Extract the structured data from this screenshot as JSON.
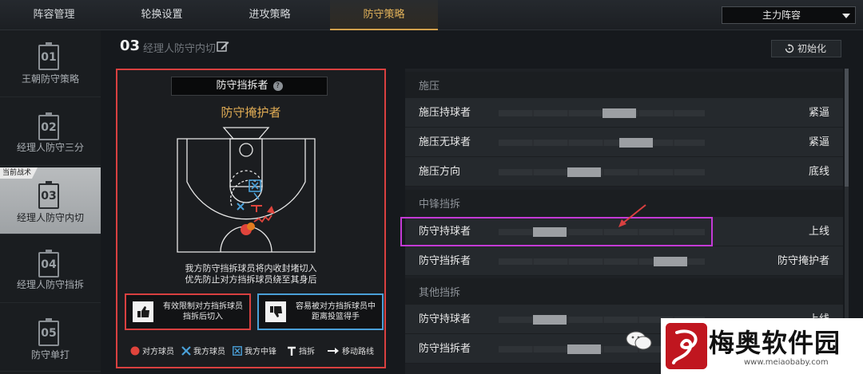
{
  "top_tabs": [
    "阵容管理",
    "轮换设置",
    "进攻策略",
    "防守策略"
  ],
  "active_tab": "防守策略",
  "lineup_select": "主力阵容",
  "sidebar": {
    "items": [
      {
        "num": "01",
        "label": "王朝防守策略"
      },
      {
        "num": "02",
        "label": "经理人防守三分"
      },
      {
        "num": "03",
        "label": "经理人防守内切"
      },
      {
        "num": "04",
        "label": "经理人防守挡拆"
      },
      {
        "num": "05",
        "label": "防守单打"
      }
    ],
    "current_tag": "当前战术"
  },
  "header": {
    "num": "03",
    "title": "经理人防守内切",
    "reset_label": "初始化"
  },
  "panel": {
    "title": "防守挡拆者",
    "help": "?",
    "subtitle": "防守掩护者",
    "desc_line1": "我方防守挡拆球员将内收封堵切入",
    "desc_line2": "优先防止对方挡拆球员绕至其身后",
    "pro_line1": "有效限制对方挡拆球员",
    "pro_line2": "挡拆后切入",
    "con_line1": "容易被对方挡拆球员中",
    "con_line2": "距离投篮得手",
    "legend": [
      "对方球员",
      "我方球员",
      "我方中锋",
      "挡拆",
      "移动路线"
    ]
  },
  "settings": {
    "sections": [
      {
        "title": "施压",
        "rows": [
          {
            "label": "施压持球者",
            "value": "紧逼",
            "level": 0.6
          },
          {
            "label": "施压无球者",
            "value": "紧逼",
            "level": 0.7
          },
          {
            "label": "施压方向",
            "value": "底线",
            "level": 0.4
          }
        ]
      },
      {
        "title": "中锋挡拆",
        "rows": [
          {
            "label": "防守持球者",
            "value": "上线",
            "level": 0.2
          },
          {
            "label": "防守挡拆者",
            "value": "防守掩护者",
            "level": 0.9
          }
        ]
      },
      {
        "title": "其他挡拆",
        "rows": [
          {
            "label": "防守持球者",
            "value": "上线",
            "level": 0.2
          },
          {
            "label": "防守挡拆者",
            "value": "",
            "level": 0.4
          }
        ]
      }
    ]
  },
  "watermark": {
    "name": "梅奥软件园",
    "url": "www.meiaobaby.com"
  },
  "colors": {
    "accent": "#e2ad55",
    "highlight": "#c43ad6",
    "panel_border": "#d94040",
    "con_border": "#4aa0d8"
  }
}
